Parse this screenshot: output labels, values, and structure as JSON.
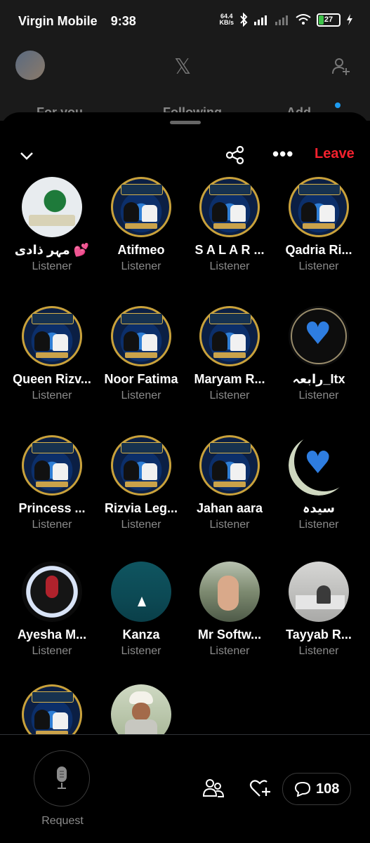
{
  "status_bar": {
    "carrier": "Virgin Mobile",
    "time": "9:38",
    "network_speed": "64.4",
    "network_speed_unit": "KB/s",
    "battery_level": "27"
  },
  "app_header": {
    "tabs": [
      "For you",
      "Following",
      "Add"
    ]
  },
  "space": {
    "leave_label": "Leave"
  },
  "participants": [
    {
      "name": "مہر ذادی 💕",
      "role": "Listener",
      "avatar": "green-dome"
    },
    {
      "name": "Atifmeo",
      "role": "Listener",
      "avatar": "emblem"
    },
    {
      "name": "S A L A R ...",
      "role": "Listener",
      "avatar": "emblem"
    },
    {
      "name": "Qadria Ri...",
      "role": "Listener",
      "avatar": "emblem"
    },
    {
      "name": "Queen Rizv...",
      "role": "Listener",
      "avatar": "emblem"
    },
    {
      "name": "Noor Fatima",
      "role": "Listener",
      "avatar": "emblem"
    },
    {
      "name": "Maryam R...",
      "role": "Listener",
      "avatar": "emblem"
    },
    {
      "name": "رابعہ_Itx",
      "role": "Listener",
      "avatar": "blue-heart-dark"
    },
    {
      "name": "Princess ...",
      "role": "Listener",
      "avatar": "emblem"
    },
    {
      "name": "Rizvia Leg...",
      "role": "Listener",
      "avatar": "emblem"
    },
    {
      "name": "Jahan aara",
      "role": "Listener",
      "avatar": "emblem"
    },
    {
      "name": "سیدہ",
      "role": "Listener",
      "avatar": "blue-heart-moon"
    },
    {
      "name": "Ayesha M...",
      "role": "Listener",
      "avatar": "red-figure"
    },
    {
      "name": "Kanza",
      "role": "Listener",
      "avatar": "sea-boat"
    },
    {
      "name": "Mr Softw...",
      "role": "Listener",
      "avatar": "crowd-hand"
    },
    {
      "name": "Tayyab R...",
      "role": "Listener",
      "avatar": "office-man"
    },
    {
      "name": "",
      "role": "",
      "avatar": "emblem"
    },
    {
      "name": "",
      "role": "",
      "avatar": "elder-man"
    }
  ],
  "bottom_bar": {
    "request_label": "Request",
    "reply_count": "108"
  },
  "colors": {
    "leave": "#f4212e",
    "accent": "#1d9bf0",
    "secondary_text": "#8b8b8b"
  }
}
